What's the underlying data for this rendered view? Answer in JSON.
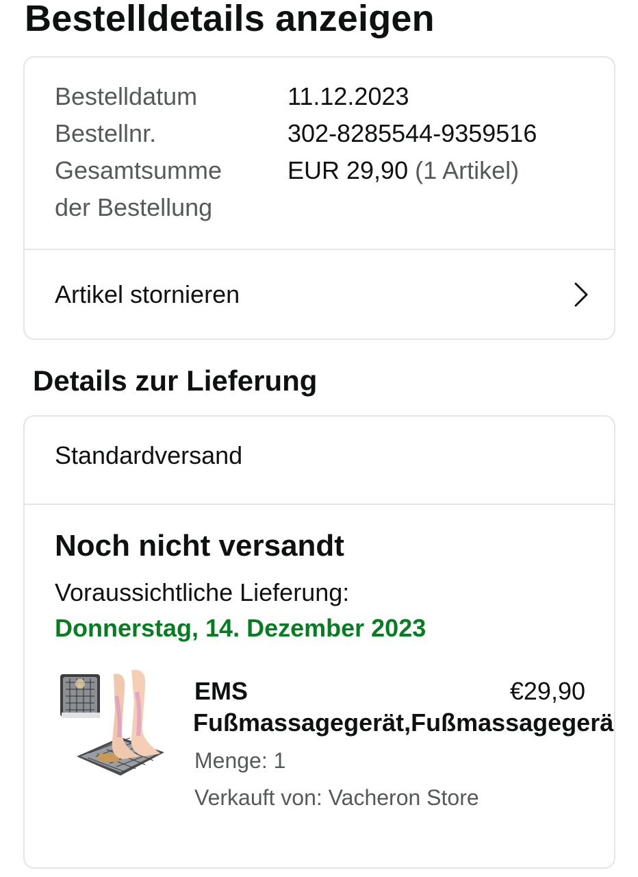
{
  "page": {
    "title": "Bestelldetails anzeigen"
  },
  "summary": {
    "order_date_label": "Bestelldatum",
    "order_date": "11.12.2023",
    "order_number_label": "Bestellnr.",
    "order_number": "302-8285544-9359516",
    "total_label_line1": "Gesamtsumme",
    "total_label_line2": "der Bestellung",
    "total_amount": "EUR 29,90",
    "total_items": "(1 Artikel)",
    "cancel_label": "Artikel stornieren"
  },
  "delivery": {
    "section_title": "Details zur Lieferung",
    "shipping_method": "Standardversand",
    "status": "Noch nicht versandt",
    "estimate_label": "Voraussichtliche Lieferung:",
    "estimate_date": "Donnerstag, 14. Dezember 2023",
    "estimate_color": "#067d20",
    "item": {
      "name_line1": "EMS",
      "name_line2": "Fußmassagegerät,Fußmassagegerä",
      "price": "€29,90",
      "quantity": "Menge: 1",
      "seller": "Verkauft von: Vacheron Store",
      "image": "product-image"
    }
  },
  "icons": {
    "cancel_chevron": "chevron-right-icon"
  }
}
